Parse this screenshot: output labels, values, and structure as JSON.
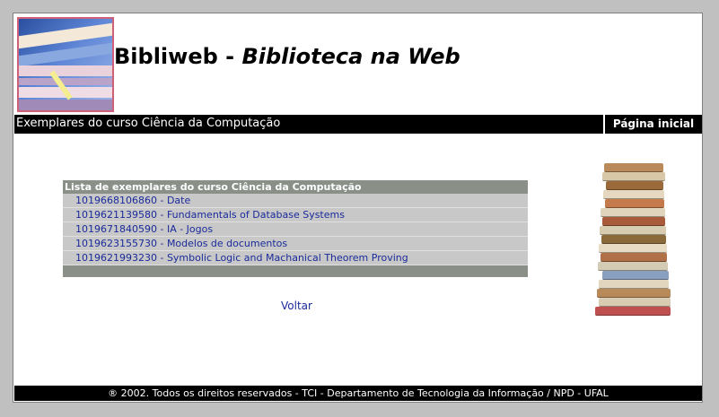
{
  "header": {
    "title_main": "Bibliweb - ",
    "title_sub": "Biblioteca na Web"
  },
  "navbar": {
    "page_heading": "Exemplares do curso Ciência da Computação",
    "home_link": "Página inicial"
  },
  "list": {
    "header": "Lista de exemplares do curso Ciência da Computação",
    "items": [
      "1019668106860 - Date",
      "1019621139580 - Fundamentals of Database Systems",
      "1019671840590 - IA - Jogos",
      "1019623155730 - Modelos de documentos",
      "1019621993230 - Symbolic Logic and Machanical Theorem Proving"
    ]
  },
  "back_link": "Voltar",
  "footer": "® 2002. Todos os direitos reservados - TCI - Departamento de Tecnologia da Informação / NPD - UFAL",
  "colors": {
    "background": "#c0c0c0",
    "bar": "#000000",
    "list_header": "#8a9088",
    "link": "#1a2a9a"
  },
  "icons": [
    "books-logo-image",
    "book-stack-image"
  ]
}
